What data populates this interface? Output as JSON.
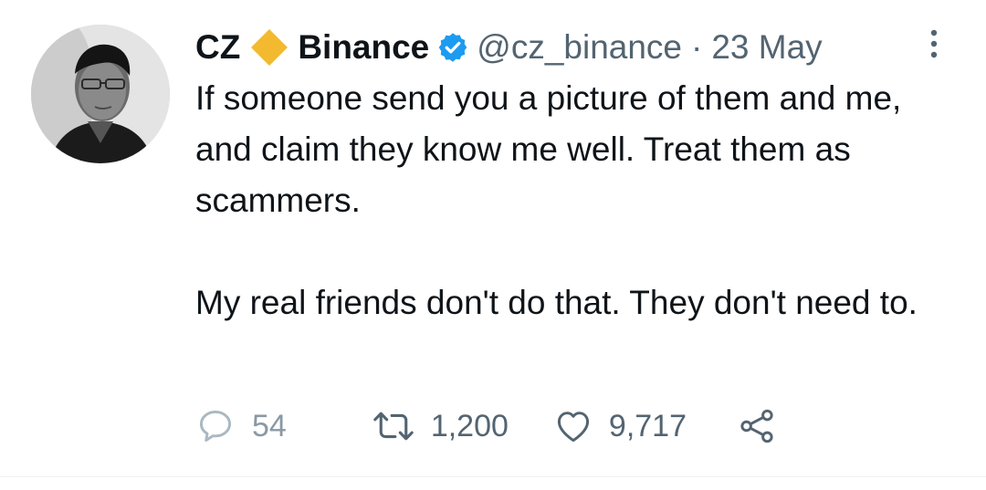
{
  "author": {
    "name": "CZ",
    "affiliation": "Binance",
    "handle": "@cz_binance",
    "separator": "·",
    "date": "23 May"
  },
  "tweet": {
    "paragraphs": [
      "If someone send you a picture of them and me, and claim they know me well. Treat them as scammers.",
      "My real friends don't do that. They don't need to."
    ]
  },
  "actions": {
    "replies": "54",
    "retweets": "1,200",
    "likes": "9,717"
  },
  "icons": {
    "diamond": "binance-diamond-icon",
    "verified": "verified-badge-icon",
    "more": "more-vertical-icon",
    "reply": "reply-icon",
    "retweet": "retweet-icon",
    "like": "heart-icon",
    "share": "share-icon"
  },
  "colors": {
    "binance_yellow": "#F3BA2F",
    "verified_blue": "#1D9BF0",
    "secondary_text": "#536471",
    "primary_text": "#0F1419"
  }
}
